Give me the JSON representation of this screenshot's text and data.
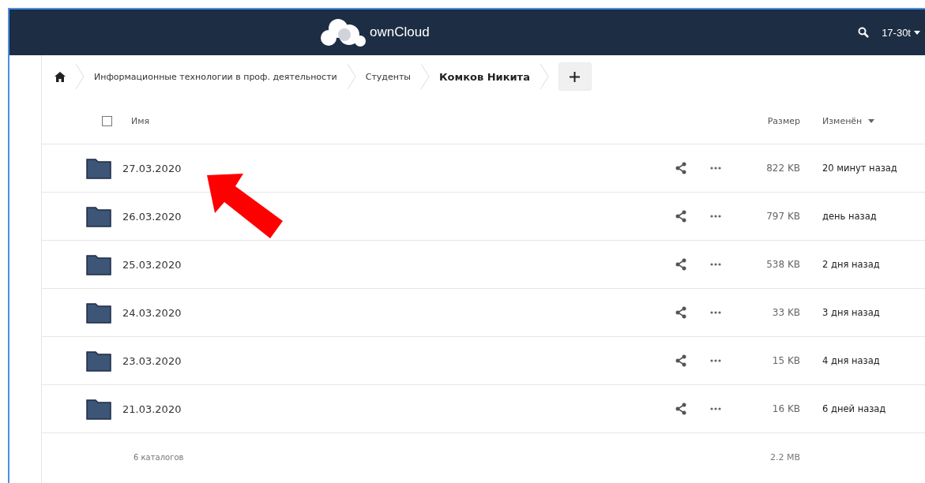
{
  "header": {
    "app_name": "ownCloud",
    "user": "17-30t"
  },
  "breadcrumbs": [
    {
      "label": "Информационные технологии в проф. деятельности",
      "current": false
    },
    {
      "label": "Студенты",
      "current": false
    },
    {
      "label": "Комков Никита",
      "current": true
    }
  ],
  "table": {
    "columns": {
      "name": "Имя",
      "size": "Размер",
      "modified": "Изменён"
    },
    "select_all": {
      "checked": false
    },
    "rows": [
      {
        "name": "27.03.2020",
        "size": "822 KB",
        "modified": "20 минут назад"
      },
      {
        "name": "26.03.2020",
        "size": "797 KB",
        "modified": "день назад"
      },
      {
        "name": "25.03.2020",
        "size": "538 KB",
        "modified": "2 дня назад"
      },
      {
        "name": "24.03.2020",
        "size": "33 KB",
        "modified": "3 дня назад"
      },
      {
        "name": "23.03.2020",
        "size": "15 KB",
        "modified": "4 дня назад"
      },
      {
        "name": "21.03.2020",
        "size": "16 KB",
        "modified": "6 дней назад"
      }
    ],
    "summary": {
      "count": "6 каталогов",
      "total": "2.2 MB"
    }
  }
}
